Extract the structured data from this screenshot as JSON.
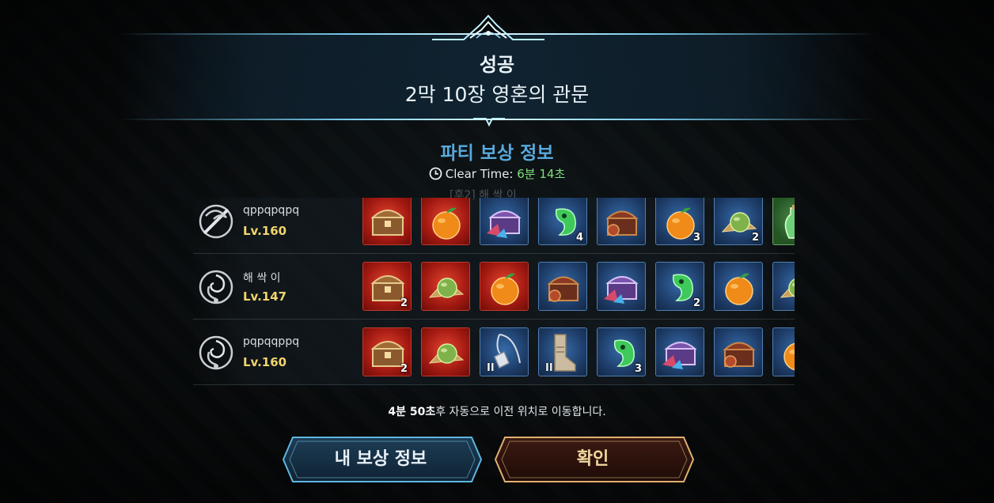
{
  "header": {
    "status": "성공",
    "stage": "2막 10장 영혼의 관문"
  },
  "reward_title": "파티 보상 정보",
  "clear_time": {
    "label": "Clear Time:",
    "value": "6분 14초"
  },
  "ghost_text": "[후2] 해 싹 이",
  "players": [
    {
      "name": "qppqpqpq",
      "level": "Lv.160",
      "emblem": "dragon-sword-emblem",
      "items": [
        {
          "icon": "treasure-chest",
          "bg": "red",
          "qty": ""
        },
        {
          "icon": "orange-fruit",
          "bg": "red",
          "qty": ""
        },
        {
          "icon": "purple-chest",
          "bg": "blue",
          "qty": ""
        },
        {
          "icon": "green-jade",
          "bg": "blue",
          "qty": "4"
        },
        {
          "icon": "wooden-chest",
          "bg": "blue",
          "qty": ""
        },
        {
          "icon": "orange-fruit",
          "bg": "blue",
          "qty": "3"
        },
        {
          "icon": "green-fruit",
          "bg": "blue",
          "qty": "2"
        },
        {
          "icon": "potion",
          "bg": "green",
          "qty": ""
        }
      ]
    },
    {
      "name": "해 싹 이",
      "level": "Lv.147",
      "emblem": "spiral-emblem",
      "items": [
        {
          "icon": "treasure-chest",
          "bg": "red",
          "qty": "2"
        },
        {
          "icon": "green-fruit",
          "bg": "red",
          "qty": ""
        },
        {
          "icon": "orange-fruit",
          "bg": "red",
          "qty": ""
        },
        {
          "icon": "wooden-chest",
          "bg": "blue",
          "qty": ""
        },
        {
          "icon": "purple-chest",
          "bg": "blue",
          "qty": ""
        },
        {
          "icon": "green-jade",
          "bg": "blue",
          "qty": "2"
        },
        {
          "icon": "orange-fruit",
          "bg": "blue",
          "qty": ""
        },
        {
          "icon": "green-fruit",
          "bg": "blue",
          "qty": ""
        }
      ]
    },
    {
      "name": "pqpqqppq",
      "level": "Lv.160",
      "emblem": "spiral-emblem",
      "items": [
        {
          "icon": "treasure-chest",
          "bg": "red",
          "qty": "2"
        },
        {
          "icon": "green-fruit",
          "bg": "red",
          "qty": ""
        },
        {
          "icon": "necklace",
          "bg": "blue",
          "qty": "",
          "grade": "II"
        },
        {
          "icon": "boots",
          "bg": "blue",
          "qty": "",
          "grade": "II"
        },
        {
          "icon": "green-jade",
          "bg": "blue",
          "qty": "3"
        },
        {
          "icon": "purple-chest",
          "bg": "blue",
          "qty": ""
        },
        {
          "icon": "wooden-chest",
          "bg": "blue",
          "qty": ""
        },
        {
          "icon": "orange-fruit",
          "bg": "blue",
          "qty": ""
        }
      ]
    }
  ],
  "notice": {
    "time": "4분 50초",
    "text": "후 자동으로 이전 위치로 이동합니다."
  },
  "buttons": {
    "my_reward": "내 보상 정보",
    "confirm": "확인"
  },
  "colors": {
    "accent_blue": "#58a9dc",
    "time_green": "#7ee07a",
    "level_gold": "#f1d46a"
  }
}
